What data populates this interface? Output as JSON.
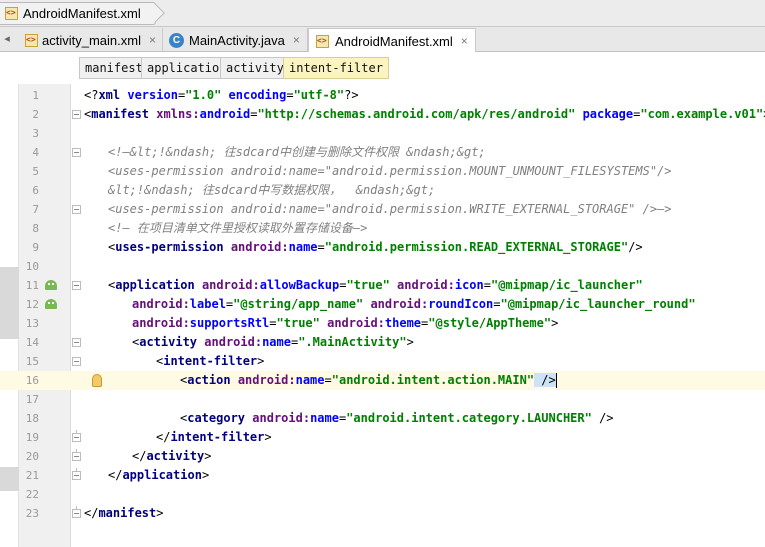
{
  "breadcrumb": {
    "file": "AndroidManifest.xml"
  },
  "tabs": [
    {
      "label": "activity_main.xml",
      "icon": "xml-file-icon",
      "active": false
    },
    {
      "label": "MainActivity.java",
      "icon": "java-class-icon",
      "active": false
    },
    {
      "label": "AndroidManifest.xml",
      "icon": "xml-file-icon",
      "active": true
    }
  ],
  "tab_close_glyph": "×",
  "tag_path": [
    "manifest",
    "application",
    "activity",
    "intent-filter"
  ],
  "editor": {
    "current_line": 16,
    "lines": [
      {
        "n": "1",
        "indent": 0,
        "tokens": [
          [
            "punct",
            "<?"
          ],
          [
            "tag",
            "xml "
          ],
          [
            "attr",
            "version"
          ],
          [
            "punct",
            "="
          ],
          [
            "val",
            "\"1.0\""
          ],
          [
            "punct",
            " "
          ],
          [
            "attr",
            "encoding"
          ],
          [
            "punct",
            "="
          ],
          [
            "val",
            "\"utf-8\""
          ],
          [
            "punct",
            "?>"
          ]
        ]
      },
      {
        "n": "2",
        "indent": 0,
        "fold": true,
        "tokens": [
          [
            "punct",
            "<"
          ],
          [
            "tag",
            "manifest "
          ],
          [
            "ns",
            "xmlns:"
          ],
          [
            "attr",
            "android"
          ],
          [
            "punct",
            "="
          ],
          [
            "val",
            "\"http://schemas.android.com/apk/res/android\""
          ],
          [
            "punct",
            " "
          ],
          [
            "attr",
            "package"
          ],
          [
            "punct",
            "="
          ],
          [
            "val",
            "\"com.example.v01\""
          ],
          [
            "punct",
            ">"
          ]
        ]
      },
      {
        "n": "3",
        "indent": 0,
        "tokens": []
      },
      {
        "n": "4",
        "indent": 4,
        "fold": true,
        "tokens": [
          [
            "com",
            "<!—&lt;!&ndash; 往sdcard中创建与删除文件权限 &ndash;&gt;"
          ]
        ]
      },
      {
        "n": "5",
        "indent": 4,
        "tokens": [
          [
            "com",
            "<uses-permission android:name=\"android.permission.MOUNT_UNMOUNT_FILESYSTEMS\"/>"
          ]
        ]
      },
      {
        "n": "6",
        "indent": 4,
        "tokens": [
          [
            "com",
            "&lt;!&ndash; 往sdcard中写数据权限，  &ndash;&gt;"
          ]
        ]
      },
      {
        "n": "7",
        "indent": 4,
        "fold": true,
        "tokens": [
          [
            "com",
            "<uses-permission android:name=\"android.permission.WRITE_EXTERNAL_STORAGE\" />—>"
          ]
        ]
      },
      {
        "n": "8",
        "indent": 4,
        "tokens": [
          [
            "com",
            "<!— 在项目清单文件里授权读取外置存储设备—>"
          ]
        ]
      },
      {
        "n": "9",
        "indent": 4,
        "tokens": [
          [
            "punct",
            "<"
          ],
          [
            "tag",
            "uses-permission "
          ],
          [
            "ns",
            "android:"
          ],
          [
            "attr",
            "name"
          ],
          [
            "punct",
            "="
          ],
          [
            "val",
            "\"android.permission.READ_EXTERNAL_STORAGE\""
          ],
          [
            "punct",
            "/>"
          ]
        ]
      },
      {
        "n": "10",
        "indent": 0,
        "tokens": []
      },
      {
        "n": "11",
        "indent": 4,
        "fold": true,
        "icon": "android-icon",
        "tokens": [
          [
            "punct",
            "<"
          ],
          [
            "tag",
            "application "
          ],
          [
            "ns",
            "android:"
          ],
          [
            "attr",
            "allowBackup"
          ],
          [
            "punct",
            "="
          ],
          [
            "val",
            "\"true\""
          ],
          [
            "punct",
            " "
          ],
          [
            "ns",
            "android:"
          ],
          [
            "attr",
            "icon"
          ],
          [
            "punct",
            "="
          ],
          [
            "val",
            "\"@mipmap/ic_launcher\""
          ]
        ]
      },
      {
        "n": "12",
        "indent": 8,
        "icon": "android-icon",
        "tokens": [
          [
            "ns",
            "android:"
          ],
          [
            "attr",
            "label"
          ],
          [
            "punct",
            "="
          ],
          [
            "val",
            "\"@string/app_name\""
          ],
          [
            "punct",
            " "
          ],
          [
            "ns",
            "android:"
          ],
          [
            "attr",
            "roundIcon"
          ],
          [
            "punct",
            "="
          ],
          [
            "val",
            "\"@mipmap/ic_launcher_round\""
          ]
        ]
      },
      {
        "n": "13",
        "indent": 8,
        "tokens": [
          [
            "ns",
            "android:"
          ],
          [
            "attr",
            "supportsRtl"
          ],
          [
            "punct",
            "="
          ],
          [
            "val",
            "\"true\""
          ],
          [
            "punct",
            " "
          ],
          [
            "ns",
            "android:"
          ],
          [
            "attr",
            "theme"
          ],
          [
            "punct",
            "="
          ],
          [
            "val",
            "\"@style/AppTheme\""
          ],
          [
            "punct",
            ">"
          ]
        ]
      },
      {
        "n": "14",
        "indent": 8,
        "fold": true,
        "tokens": [
          [
            "punct",
            "<"
          ],
          [
            "tag",
            "activity "
          ],
          [
            "ns",
            "android:"
          ],
          [
            "attr",
            "name"
          ],
          [
            "punct",
            "="
          ],
          [
            "val",
            "\".MainActivity\""
          ],
          [
            "punct",
            ">"
          ]
        ]
      },
      {
        "n": "15",
        "indent": 12,
        "fold": true,
        "tokens": [
          [
            "punct",
            "<"
          ],
          [
            "tag",
            "intent-filter"
          ],
          [
            "punct",
            ">"
          ]
        ]
      },
      {
        "n": "16",
        "indent": 16,
        "bulb": true,
        "tokens": [
          [
            "punct",
            "<"
          ],
          [
            "tag",
            "action "
          ],
          [
            "ns",
            "android:"
          ],
          [
            "attr",
            "name"
          ],
          [
            "punct",
            "="
          ],
          [
            "val",
            "\"android.intent.action.MAIN\""
          ],
          [
            "punct",
            " />"
          ]
        ]
      },
      {
        "n": "17",
        "indent": 0,
        "tokens": []
      },
      {
        "n": "18",
        "indent": 16,
        "tokens": [
          [
            "punct",
            "<"
          ],
          [
            "tag",
            "category "
          ],
          [
            "ns",
            "android:"
          ],
          [
            "attr",
            "name"
          ],
          [
            "punct",
            "="
          ],
          [
            "val",
            "\"android.intent.category.LAUNCHER\""
          ],
          [
            "punct",
            " />"
          ]
        ]
      },
      {
        "n": "19",
        "indent": 12,
        "fold": "end",
        "tokens": [
          [
            "punct",
            "</"
          ],
          [
            "tag",
            "intent-filter"
          ],
          [
            "punct",
            ">"
          ]
        ]
      },
      {
        "n": "20",
        "indent": 8,
        "fold": "end",
        "tokens": [
          [
            "punct",
            "</"
          ],
          [
            "tag",
            "activity"
          ],
          [
            "punct",
            ">"
          ]
        ]
      },
      {
        "n": "21",
        "indent": 4,
        "fold": "end",
        "tokens": [
          [
            "punct",
            "</"
          ],
          [
            "tag",
            "application"
          ],
          [
            "punct",
            ">"
          ]
        ]
      },
      {
        "n": "22",
        "indent": 0,
        "tokens": []
      },
      {
        "n": "23",
        "indent": 0,
        "fold": "end",
        "tokens": [
          [
            "punct",
            "</"
          ],
          [
            "tag",
            "manifest"
          ],
          [
            "punct",
            ">"
          ]
        ]
      }
    ]
  }
}
